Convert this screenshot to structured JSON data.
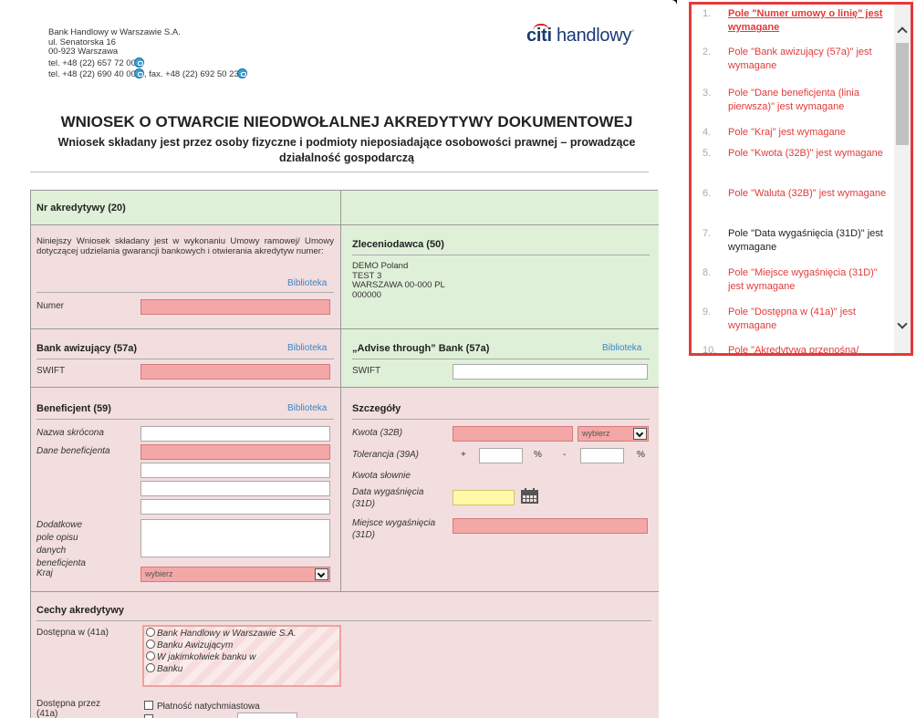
{
  "bank": {
    "lines": [
      "Bank Handlowy w Warszawie S.A.",
      "ul. Senatorska 16",
      "00-923 Warszawa"
    ],
    "phone1": "tel. +48 (22) 657 72 00",
    "phone2": "tel. +48 (22) 690 40 00",
    "fax": ", fax. +48 (22) 692 50 23"
  },
  "logo": {
    "citi": "citi",
    "rest": " handlowy"
  },
  "form": {
    "title": "WNIOSEK O OTWARCIE NIEODWOŁALNEJ AKREDYTYWY DOKUMENTOWEJ",
    "subtitle": "Wniosek składany jest przez osoby fizyczne i podmioty nieposiadające osobowości prawnej – prowadzące działalność gospodarczą",
    "nr_header": "Nr akredytywy (20)",
    "umowa_text": "Niniejszy Wniosek składany jest w wykonaniu Umowy ramowej/ Umowy dotyczącej udzielania gwarancji bankowych i otwierania akredytyw numer:",
    "biblioteka": "Biblioteka",
    "numer_label": "Numer",
    "zleceniodawca_header": "Zleceniodawca (50)",
    "zleceniodawca_lines": [
      "DEMO Poland",
      "TEST 3",
      "WARSZAWA 00-000 PL",
      "000000"
    ],
    "bank_aw_header": "Bank awizujący (57a)",
    "advise_header": "„Advise through” Bank (57a)",
    "swift": "SWIFT",
    "beneficjent_header": "Beneficjent (59)",
    "nazwa_skrocona": "Nazwa skrócona",
    "dane_beneficjenta": "Dane beneficjenta",
    "dodatkowe_pole": "Dodatkowe pole opisu danych beneficjenta",
    "kraj": "Kraj",
    "kraj_value": "wybierz",
    "szczegoly_header": "Szczegóły",
    "kwota": "Kwota (32B)",
    "waluta_value": "wybierz",
    "tolerancja": "Tolerancja (39A)",
    "plus": "+",
    "minus": "-",
    "percent": "%",
    "kwota_slownie": "Kwota słownie",
    "data_wygasniecia": "Data wygaśnięcia (31D)",
    "miejsce_wygasniecia": "Miejsce wygaśnięcia (31D)",
    "cechy_header": "Cechy akredytywy",
    "dostepna_w": "Dostępna w (41a)",
    "dostepna_opts": [
      "Bank Handlowy w Warszawie S.A.",
      "Banku Awizującym",
      "W jakimkolwiek banku w",
      "Banku"
    ],
    "dostepna_przez": "Dostępna przez (41a)",
    "platnosc": "Płatność natychmiastowa"
  },
  "errors": [
    {
      "n": "1.",
      "t": "Pole \"Numer umowy o linię\" jest wymagane",
      "style": "active"
    },
    {
      "n": "2.",
      "t": "Pole \"Bank awizujący (57a)\" jest wymagane",
      "style": "red"
    },
    {
      "n": "3.",
      "t": "Pole \"Dane beneficjenta (linia pierwsza)\" jest wymagane",
      "style": "red"
    },
    {
      "n": "4.",
      "t": "Pole \"Kraj\" jest wymagane",
      "style": "red"
    },
    {
      "n": "5.",
      "t": "Pole \"Kwota (32B)\" jest wymagane",
      "style": "red"
    },
    {
      "n": "6.",
      "t": "Pole \"Waluta (32B)\" jest wymagane",
      "style": "red"
    },
    {
      "n": "7.",
      "t": "Pole \"Data wygaśnięcia (31D)\" jest wymagane",
      "style": "black"
    },
    {
      "n": "8.",
      "t": "Pole \"Miejsce wygaśnięcia (31D)\" jest wymagane",
      "style": "red"
    },
    {
      "n": "9.",
      "t": "Pole \"Dostępna w (41a)\" jest wymagane",
      "style": "red"
    },
    {
      "n": "10.",
      "t": "Pole \"Akredytywa przenośna/",
      "style": "red"
    }
  ],
  "colors": {
    "required_field": "#f4a7a7",
    "warning_field": "#fff9a8",
    "section_green": "#dff0d8",
    "section_pink": "#f2dede",
    "error_red": "#e23a3a",
    "link_blue": "#3a84c8"
  }
}
